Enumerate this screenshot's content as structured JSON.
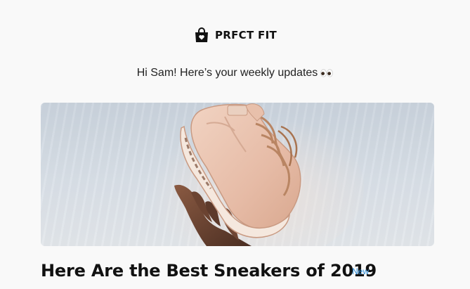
{
  "brand": {
    "name": "PRFCT FIT",
    "icon": "shopping-bag-icon"
  },
  "greeting": {
    "text": "Hi Sam! Here’s your weekly updates",
    "emoji_icon": "eyes-icon"
  },
  "hero": {
    "image": "sneaker-photo"
  },
  "article": {
    "title": "Here Are the Best Sneakers of 2019",
    "badge": "New"
  },
  "colors": {
    "background": "#f9f9f9",
    "text": "#111111",
    "badge": "#2a8bd6",
    "hero_bg": "#d5dce4",
    "sneaker": "#e9c3b0"
  }
}
